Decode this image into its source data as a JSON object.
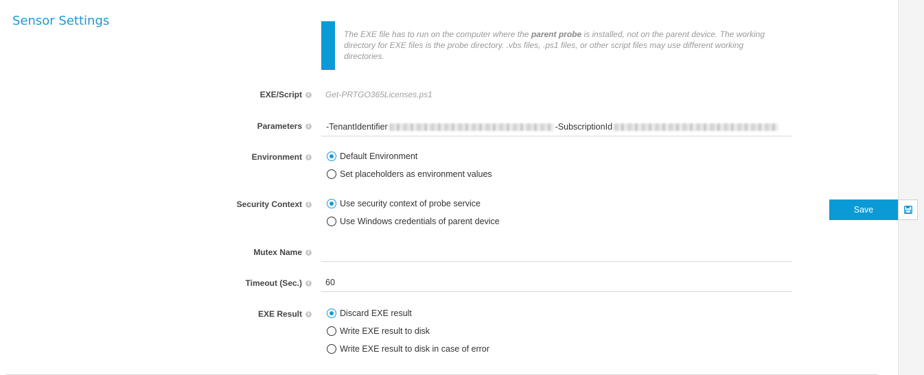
{
  "section": {
    "title": "Sensor Settings"
  },
  "note": {
    "part1": "The EXE file has to run on the computer where the ",
    "bold": "parent probe",
    "part2": " is installed, not on the parent device. The working directory for EXE files is the probe directory. .vbs files, .ps1 files, or other script files may use different working directories."
  },
  "fields": {
    "exe_script": {
      "label": "EXE/Script",
      "value": "Get-PRTGO365Licenses.ps1"
    },
    "parameters": {
      "label": "Parameters",
      "prefix1": "-TenantIdentifier",
      "prefix2": "-SubscriptionId"
    },
    "environment": {
      "label": "Environment",
      "options": [
        "Default Environment",
        "Set placeholders as environment values"
      ],
      "selected": 0
    },
    "security_context": {
      "label": "Security Context",
      "options": [
        "Use security context of probe service",
        "Use Windows credentials of parent device"
      ],
      "selected": 0
    },
    "mutex_name": {
      "label": "Mutex Name",
      "value": ""
    },
    "timeout": {
      "label": "Timeout (Sec.)",
      "value": "60"
    },
    "exe_result": {
      "label": "EXE Result",
      "options": [
        "Discard EXE result",
        "Write EXE result to disk",
        "Write EXE result to disk in case of error"
      ],
      "selected": 0
    }
  },
  "actions": {
    "save_label": "Save",
    "save_icon": "floppy-disk-icon"
  },
  "colors": {
    "accent": "#0a9ad6",
    "title": "#1a9ad6"
  },
  "icons": {
    "info": "i"
  }
}
